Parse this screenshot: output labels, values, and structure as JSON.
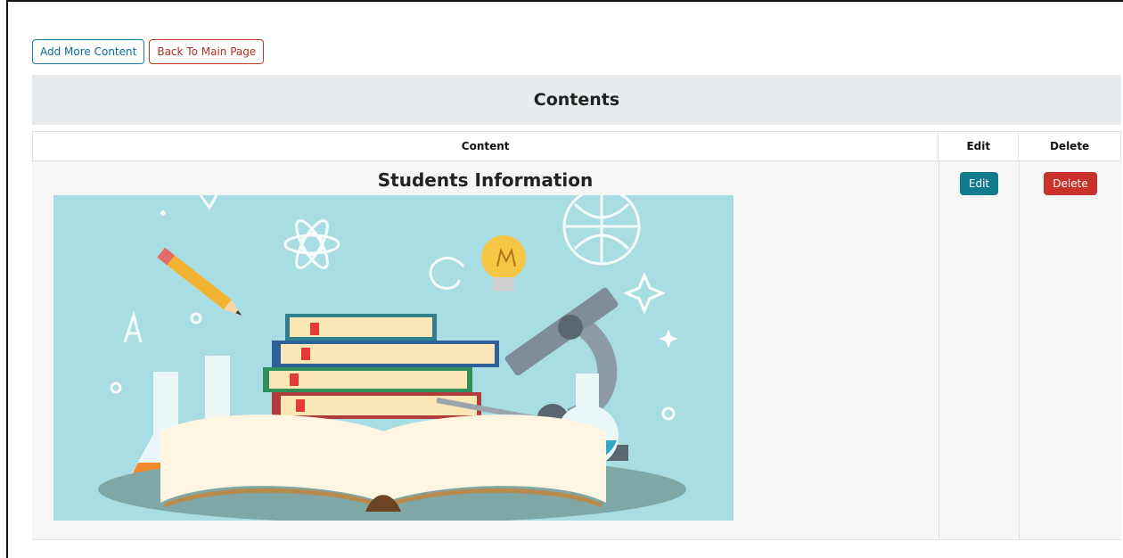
{
  "toolbar": {
    "add_label": "Add More Content",
    "back_label": "Back To Main Page"
  },
  "banner": {
    "title": "Contents"
  },
  "table": {
    "headers": [
      "Content",
      "Edit",
      "Delete"
    ],
    "rows": [
      {
        "title": "Students Information",
        "edit_label": "Edit",
        "delete_label": "Delete",
        "image": "education-illustration"
      }
    ]
  },
  "colors": {
    "info": "#1f7aa8",
    "danger": "#c8322a",
    "edit_button": "#127a8f",
    "banner_bg": "#e9ecef",
    "image_bg": "#a8dde3"
  }
}
